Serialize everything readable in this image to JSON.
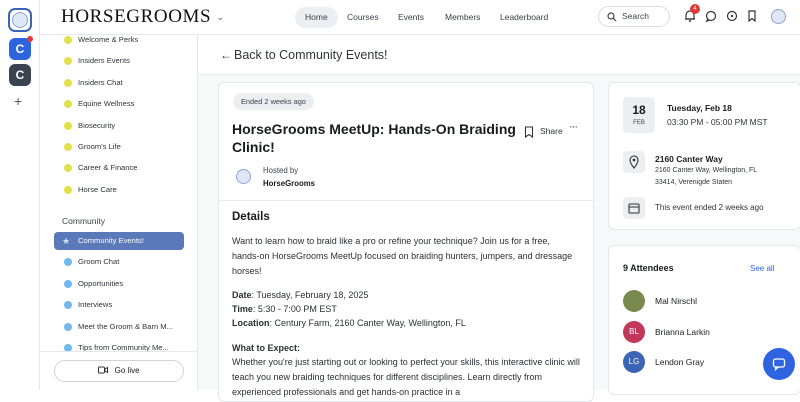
{
  "brand": "HORSEGROOMS",
  "nav": {
    "home": "Home",
    "courses": "Courses",
    "events": "Events",
    "members": "Members",
    "leaderboard": "Leaderboard",
    "search_placeholder": "Search",
    "notif_count": "4"
  },
  "rail": {
    "c1": "C",
    "c2": "C"
  },
  "sidebar": {
    "items_top": [
      {
        "label": "Welcome & Perks",
        "color": "#e3e04a"
      },
      {
        "label": "Insiders Events",
        "color": "#e3e04a"
      },
      {
        "label": "Insiders Chat",
        "color": "#e3e04a"
      },
      {
        "label": "Equine Wellness",
        "color": "#e3e04a"
      },
      {
        "label": "Biosecurity",
        "color": "#e3e04a"
      },
      {
        "label": "Groom's Life",
        "color": "#e3e04a"
      },
      {
        "label": "Career & Finance",
        "color": "#e3e04a"
      },
      {
        "label": "Horse Care",
        "color": "#e3e04a"
      }
    ],
    "section": "Community",
    "items_community": [
      {
        "label": "Community Events!",
        "color": "#6fb8f0"
      },
      {
        "label": "Groom Chat",
        "color": "#6fb8f0"
      },
      {
        "label": "Opportunities",
        "color": "#6fb8f0"
      },
      {
        "label": "Interviews",
        "color": "#6fb8f0"
      },
      {
        "label": "Meet the Groom & Barn M...",
        "color": "#6fb8f0"
      },
      {
        "label": "Tips from Community Me...",
        "color": "#6fb8f0"
      }
    ],
    "go_live": "Go live"
  },
  "back_label": "Back to Community Events!",
  "event": {
    "badge": "Ended 2 weeks ago",
    "title": "HorseGrooms MeetUp: Hands-On Braiding Clinic!",
    "share": "Share",
    "hosted_by_label": "Hosted by",
    "host": "HorseGrooms",
    "details_heading": "Details",
    "intro": "Want to learn how to braid like a pro or refine your technique? Join us for a free, hands-on HorseGrooms MeetUp focused on braiding hunters, jumpers, and dressage horses!",
    "date_label": "Date",
    "date_value": ": Tuesday, February 18, 2025",
    "time_label": "Time",
    "time_value": ": 5:30 - 7:00 PM EST",
    "location_label": "Location",
    "location_value": ": Century Farm, 2160 Canter Way, Wellington, FL",
    "expect_heading": "What to Expect:",
    "expect_text": "Whether you're just starting out or looking to perfect your skills, this interactive clinic will teach you new braiding techniques for different disciplines. Learn directly from experienced professionals and get hands-on practice in a"
  },
  "when": {
    "day": "18",
    "month": "FEB",
    "date": "Tuesday, Feb 18",
    "time": "03:30 PM - 05:00 PM MST"
  },
  "where": {
    "name": "2160 Canter Way",
    "line1": "2160 Canter Way, Wellington, FL",
    "line2": "33414, Verenigde Staten"
  },
  "ended_note": "This event ended 2 weeks ago",
  "attendees": {
    "heading": "9 Attendees",
    "see_all": "See all",
    "list": [
      {
        "name": "Mal Nirschl",
        "initials": "",
        "color": "#7a8a4f"
      },
      {
        "name": "Brianna Larkin",
        "initials": "BL",
        "color": "#c2385a"
      },
      {
        "name": "Lendon Gray",
        "initials": "LG",
        "color": "#3b64b6"
      }
    ]
  }
}
